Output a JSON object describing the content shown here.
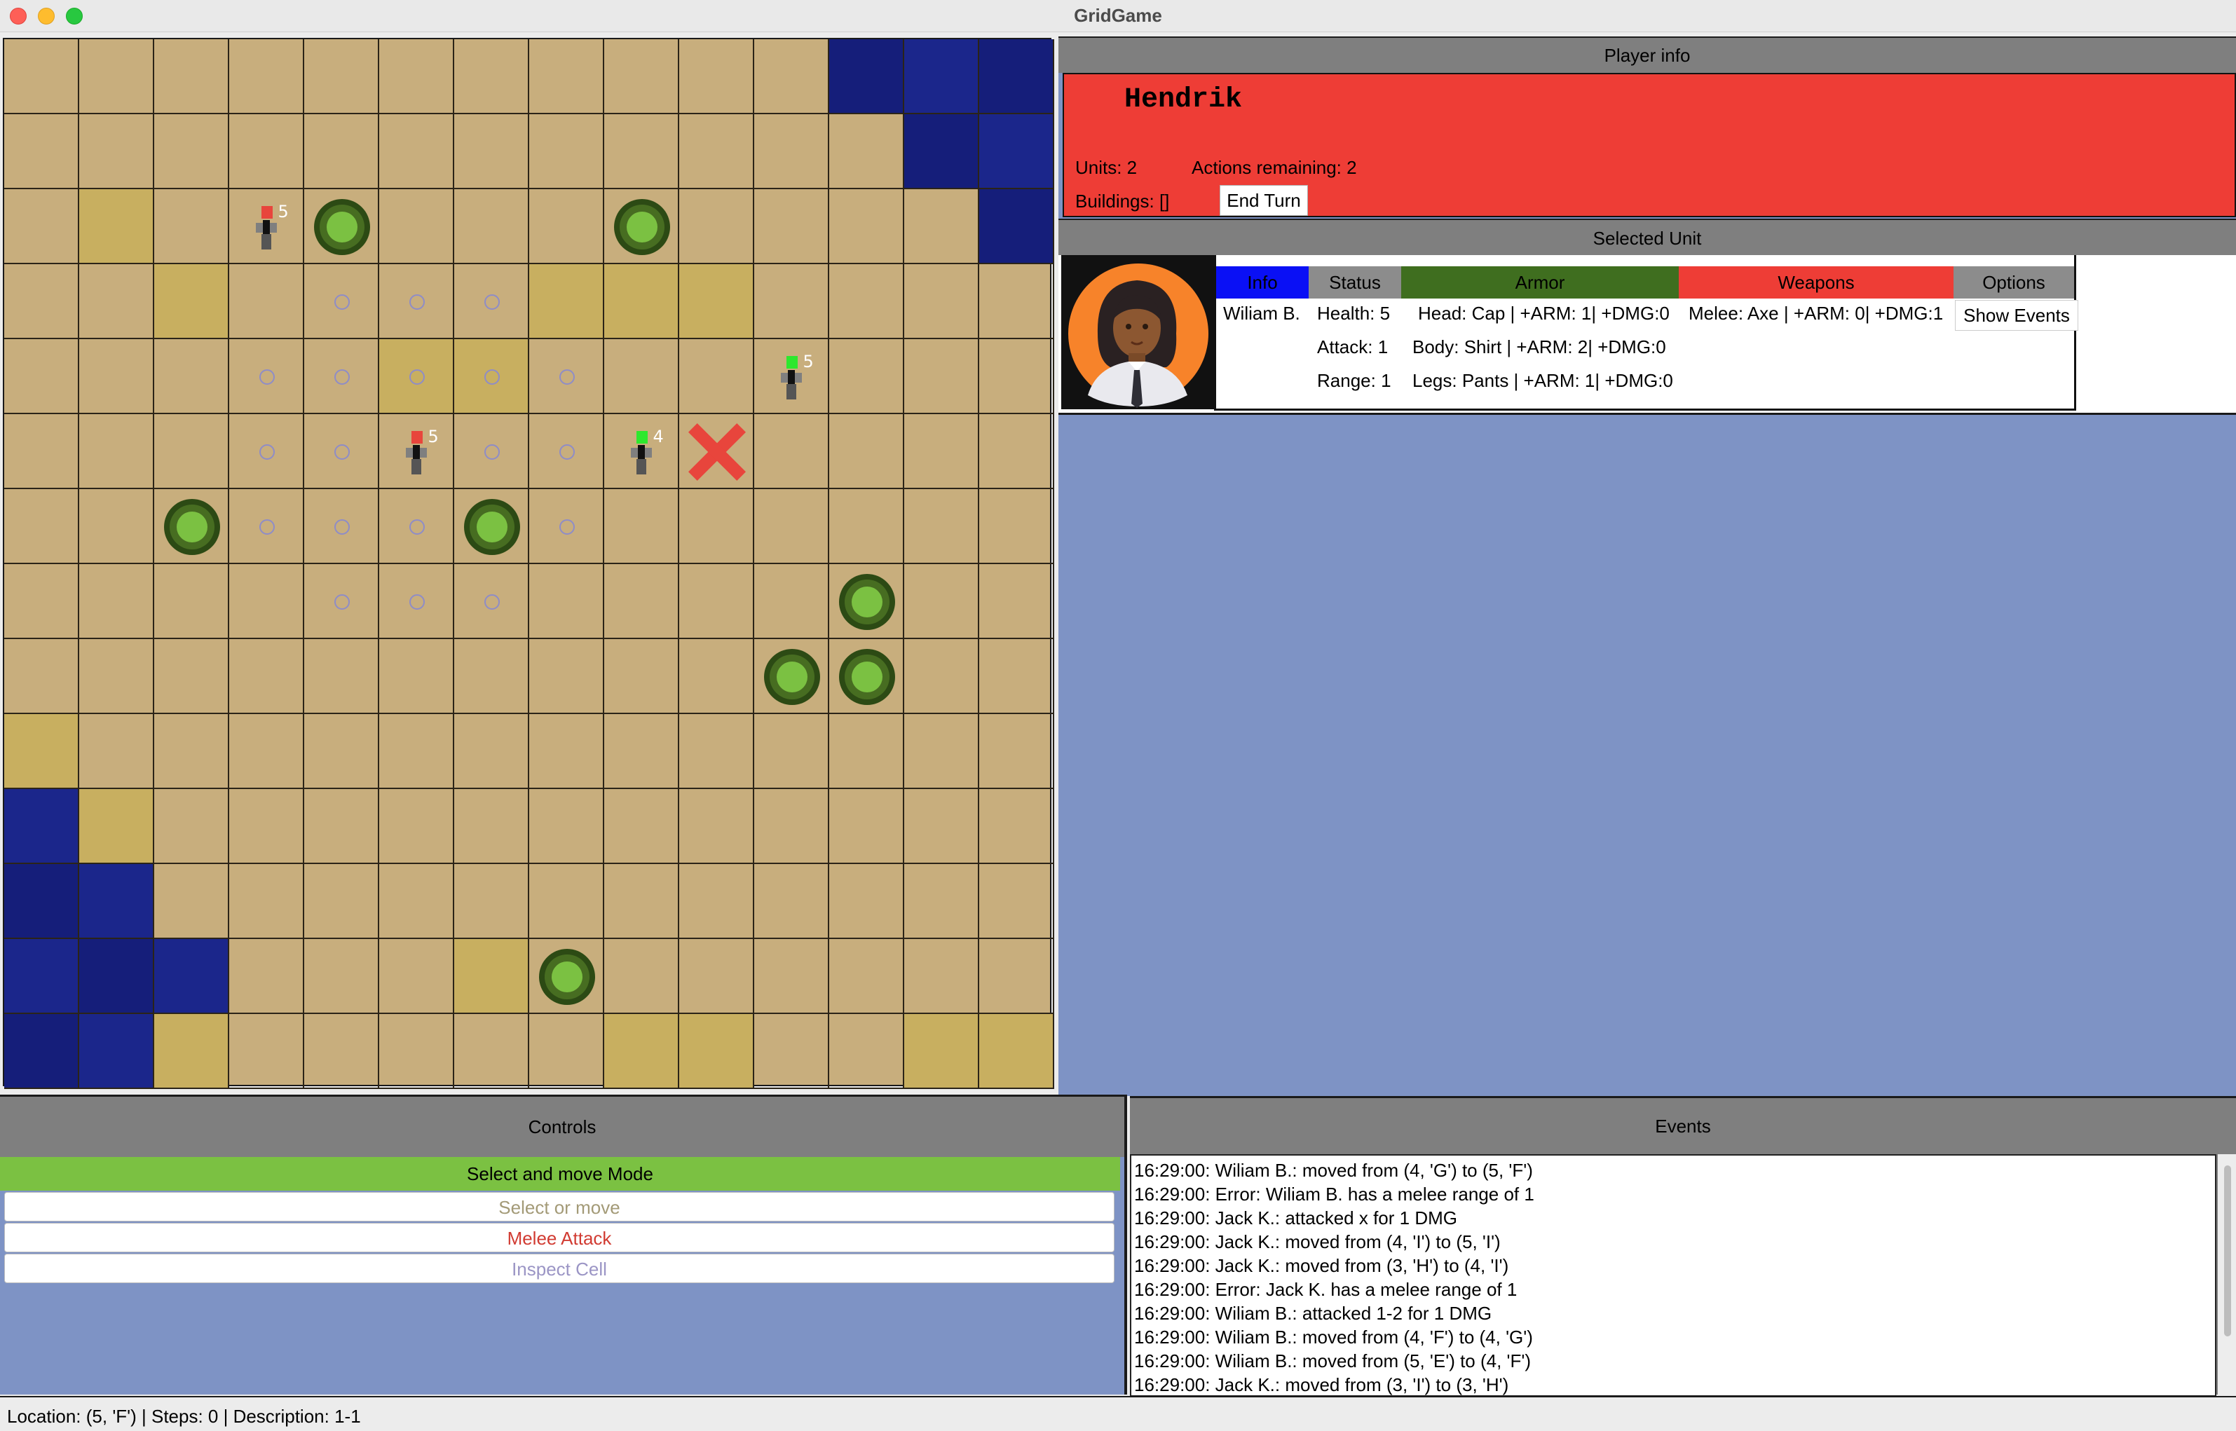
{
  "window": {
    "title": "GridGame"
  },
  "board": {
    "cols": 14,
    "rows": 14,
    "cells": [
      "...........WWW",
      "............WW",
      ".S...........W",
      "..S....SSS....",
      ".....SS.......",
      "..............",
      "..............",
      "..............",
      "..............",
      "S.............",
      "WS............",
      "WW............",
      "WWW...S.......",
      "WWS.....SS..SS"
    ],
    "trees": [
      {
        "col": 4,
        "row": 2
      },
      {
        "col": 8,
        "row": 2
      },
      {
        "col": 2,
        "row": 6
      },
      {
        "col": 6,
        "row": 6
      },
      {
        "col": 11,
        "row": 7
      },
      {
        "col": 10,
        "row": 8
      },
      {
        "col": 11,
        "row": 8
      },
      {
        "col": 7,
        "row": 12
      }
    ],
    "reach_markers": [
      {
        "col": 4,
        "row": 3
      },
      {
        "col": 5,
        "row": 3
      },
      {
        "col": 6,
        "row": 3
      },
      {
        "col": 3,
        "row": 4
      },
      {
        "col": 4,
        "row": 4
      },
      {
        "col": 5,
        "row": 4
      },
      {
        "col": 6,
        "row": 4
      },
      {
        "col": 7,
        "row": 4
      },
      {
        "col": 3,
        "row": 5
      },
      {
        "col": 4,
        "row": 5
      },
      {
        "col": 6,
        "row": 5
      },
      {
        "col": 7,
        "row": 5
      },
      {
        "col": 3,
        "row": 6
      },
      {
        "col": 4,
        "row": 6
      },
      {
        "col": 5,
        "row": 6
      },
      {
        "col": 7,
        "row": 6
      },
      {
        "col": 4,
        "row": 7
      },
      {
        "col": 5,
        "row": 7
      },
      {
        "col": 6,
        "row": 7
      }
    ],
    "units": [
      {
        "col": 3,
        "row": 2,
        "team_color": "#e8453c",
        "hp": "5"
      },
      {
        "col": 10,
        "row": 4,
        "team_color": "#2ee82e",
        "hp": "5"
      },
      {
        "col": 5,
        "row": 5,
        "team_color": "#e8453c",
        "hp": "5"
      },
      {
        "col": 8,
        "row": 5,
        "team_color": "#2ee82e",
        "hp": "4"
      }
    ],
    "target_marker": {
      "col": 9,
      "row": 5,
      "color": "#e8453c"
    },
    "colors": {
      "ground": "#c8ae7d",
      "water": "#151e7a",
      "sand": "#c8af60",
      "tree": "#7bc142"
    }
  },
  "player_info": {
    "header": "Player info",
    "name": "Hendrik",
    "units": "Units: 2",
    "actions": "Actions remaining: 2",
    "buildings": "Buildings: []",
    "end_turn_label": "End Turn",
    "color": "#ee3d36"
  },
  "selected_unit": {
    "header": "Selected Unit",
    "tabs": [
      {
        "label": "Info",
        "color": "#0a10f5"
      },
      {
        "label": "Status",
        "color": "#8c8c8c"
      },
      {
        "label": "Armor",
        "color": "#3f6e1f"
      },
      {
        "label": "Weapons",
        "color": "#ee3d36"
      },
      {
        "label": "Options",
        "color": "#8c8c8c"
      }
    ],
    "name": "Wiliam B.",
    "health": "Health: 5",
    "attack": "Attack: 1",
    "range": "Range: 1",
    "armor_head": "Head: Cap | +ARM: 1| +DMG:0",
    "armor_body": "Body: Shirt | +ARM: 2| +DMG:0",
    "armor_legs": "Legs: Pants | +ARM: 1| +DMG:0",
    "weapon_melee": "Melee: Axe | +ARM: 0| +DMG:1",
    "show_events_label": "Show Events"
  },
  "controls": {
    "header": "Controls",
    "mode": "Select and move Mode",
    "buttons": [
      {
        "label": "Select or move",
        "color": "#a39a77"
      },
      {
        "label": "Melee Attack",
        "color": "#d13b32"
      },
      {
        "label": "Inspect Cell",
        "color": "#9b95c5"
      }
    ]
  },
  "events": {
    "header": "Events",
    "lines": [
      "16:29:00: Wiliam B.: moved from (4, 'G') to (5, 'F')",
      "16:29:00: Error: Wiliam B. has a melee range of 1",
      "16:29:00: Jack K.: attacked x for 1 DMG",
      "16:29:00: Jack K.: moved from (4, 'I') to (5, 'I')",
      "16:29:00: Jack K.: moved from (3, 'H') to (4, 'I')",
      "16:29:00: Error: Jack K. has a melee range of 1",
      "16:29:00: Wiliam B.: attacked 1-2 for 1 DMG",
      "16:29:00: Wiliam B.: moved from (4, 'F') to (4, 'G')",
      "16:29:00: Wiliam B.: moved from (5, 'E') to (4, 'F')",
      "16:29:00: Jack K.: moved from (3, 'I') to (3, 'H')"
    ]
  },
  "status_bar": {
    "text": "Location: (5, 'F') | Steps: 0 | Description: 1-1"
  }
}
